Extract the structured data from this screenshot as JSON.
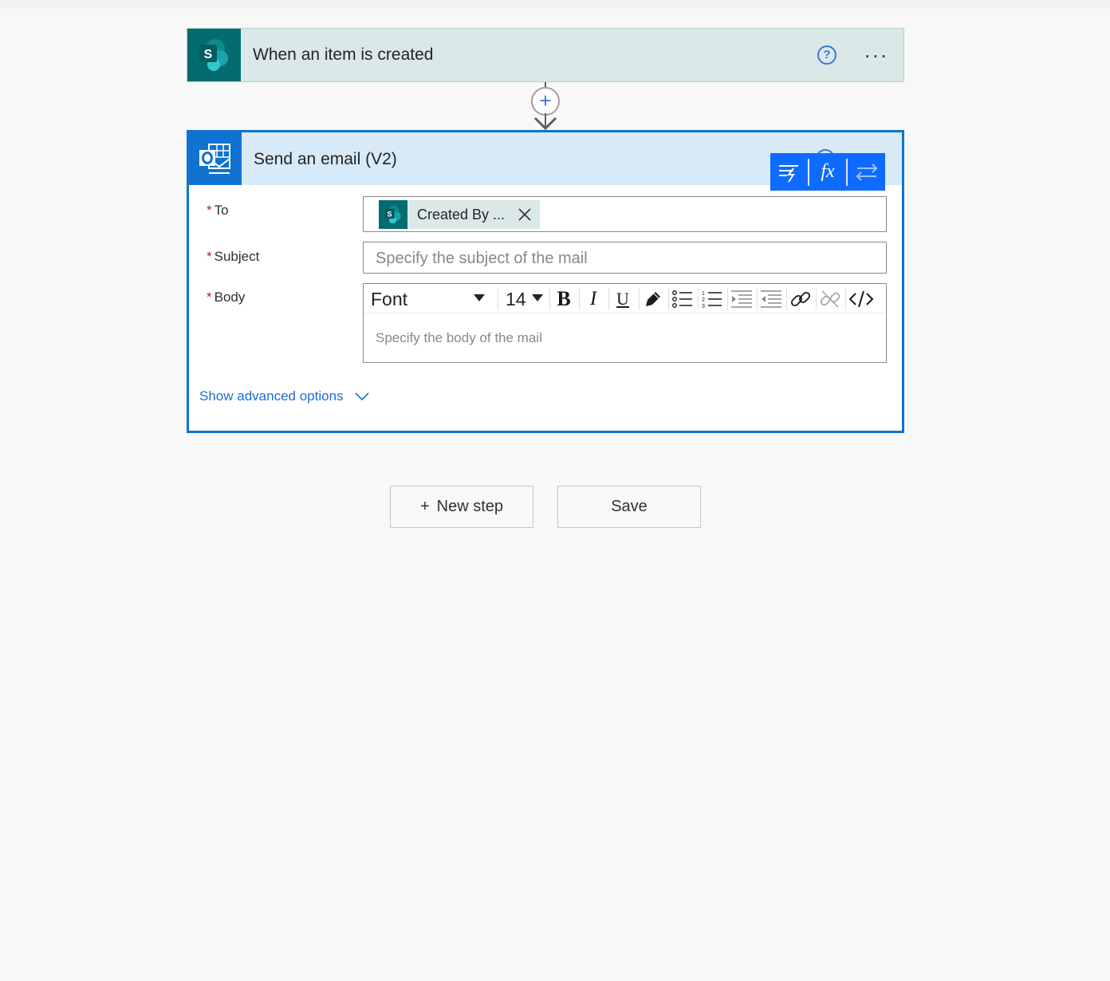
{
  "trigger": {
    "title": "When an item is created",
    "icon": "sharepoint-icon",
    "help_icon": "?",
    "more_icon": "..."
  },
  "connector": {
    "insert_icon": "+"
  },
  "action": {
    "title": "Send an email (V2)",
    "icon": "outlook-icon",
    "dynamic_toolbar": {
      "dynamic_content_icon": "dynamic-content-icon",
      "expression_label": "fx",
      "swap_icon": "swap-icon"
    },
    "fields": {
      "to": {
        "required_mark": "*",
        "label": "To",
        "token": {
          "text": "Created By ...",
          "icon": "sharepoint-icon"
        }
      },
      "subject": {
        "required_mark": "*",
        "label": "Subject",
        "placeholder": "Specify the subject of the mail"
      },
      "body": {
        "required_mark": "*",
        "label": "Body",
        "placeholder": "Specify the body of the mail",
        "toolbar": {
          "font": "Font",
          "size": "14",
          "bold": "B",
          "italic": "I",
          "underline": "U"
        }
      }
    },
    "advanced_link": "Show advanced options"
  },
  "footer": {
    "new_step_plus": "+",
    "new_step_label": "New step",
    "save_label": "Save"
  },
  "colors": {
    "accent": "#0f73d1",
    "sharepoint": "#036c70",
    "dynamic_toolbar": "#0f6bff",
    "link": "#1a6ed8"
  }
}
